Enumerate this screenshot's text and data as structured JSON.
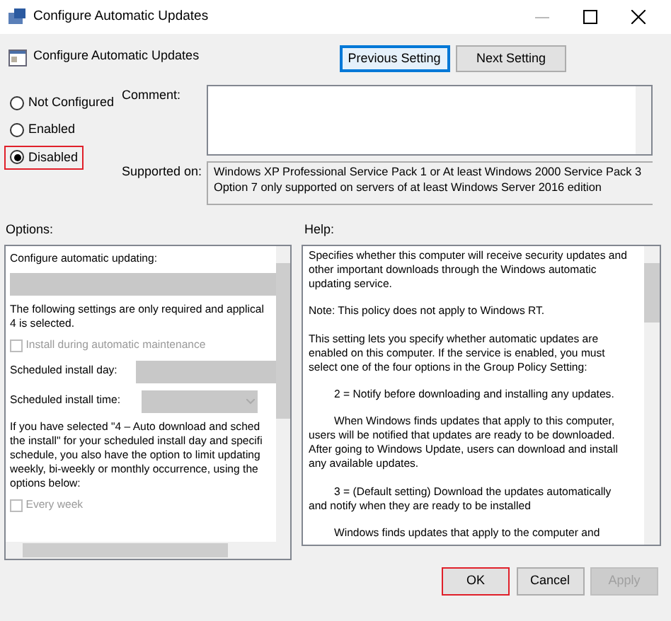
{
  "window": {
    "title": "Configure Automatic Updates"
  },
  "header": {
    "title": "Configure Automatic Updates"
  },
  "nav_buttons": [
    {
      "label": "Previous Setting",
      "focused": true
    },
    {
      "label": "Next Setting",
      "focused": false
    }
  ],
  "states": [
    {
      "label": "Not Configured",
      "selected": false,
      "highlighted": false
    },
    {
      "label": "Enabled",
      "selected": false,
      "highlighted": false
    },
    {
      "label": "Disabled",
      "selected": true,
      "highlighted": true
    }
  ],
  "comment": {
    "label": "Comment:"
  },
  "supported_on": {
    "label": "Supported on:",
    "lines": [
      "Windows XP Professional Service Pack 1 or At least Windows 2000 Service Pack 3",
      "Option 7 only supported on servers of at least Windows Server 2016 edition"
    ]
  },
  "options": {
    "label": "Options:",
    "disabled": true,
    "items": [
      {
        "kind": "text",
        "lines": [
          "Configure automatic updating:"
        ]
      },
      {
        "kind": "dropdown"
      },
      {
        "kind": "text",
        "lines": [
          "The following settings are only required and applical",
          "4 is selected."
        ]
      },
      {
        "kind": "checkbox",
        "label": "Install during automatic maintenance",
        "checked": false
      },
      {
        "kind": "field",
        "label": "Scheduled install day:"
      },
      {
        "kind": "select",
        "label": "Scheduled install time:"
      },
      {
        "kind": "text",
        "lines": [
          "If you have selected \"4 – Auto download and sched",
          "the install\" for your scheduled install day and specifi",
          "schedule, you also have the option to limit updating",
          "weekly, bi-weekly or monthly occurrence, using the",
          "options below:"
        ]
      },
      {
        "kind": "checkbox",
        "label": "Every week",
        "checked": false
      }
    ]
  },
  "help": {
    "label": "Help:",
    "paragraphs": [
      {
        "indent": false,
        "lines": [
          "Specifies whether this computer will receive security updates and",
          "other important downloads through the Windows automatic",
          "updating service."
        ]
      },
      {
        "indent": false,
        "lines": [
          "Note: This policy does not apply to Windows RT."
        ]
      },
      {
        "indent": false,
        "lines": [
          "This setting lets you specify whether automatic updates are",
          "enabled on this computer. If the service is enabled, you must",
          "select one of the four options in the Group Policy Setting:"
        ]
      },
      {
        "indent": true,
        "lines": [
          "2 = Notify before downloading and installing any updates."
        ]
      },
      {
        "indent": true,
        "lines": [
          "When Windows finds updates that apply to this computer,",
          "users will be notified that updates are ready to be downloaded.",
          "After going to Windows Update, users can download and install",
          "any available updates."
        ]
      },
      {
        "indent": true,
        "lines": [
          "3 = (Default setting) Download the updates automatically",
          "and notify when they are ready to be installed"
        ]
      },
      {
        "indent": true,
        "lines": [
          "Windows finds updates that apply to the computer and"
        ]
      }
    ]
  },
  "buttons": [
    {
      "label": "OK",
      "disabled": false,
      "highlighted": true
    },
    {
      "label": "Cancel",
      "disabled": false,
      "highlighted": false
    },
    {
      "label": "Apply",
      "disabled": true,
      "highlighted": false
    }
  ]
}
